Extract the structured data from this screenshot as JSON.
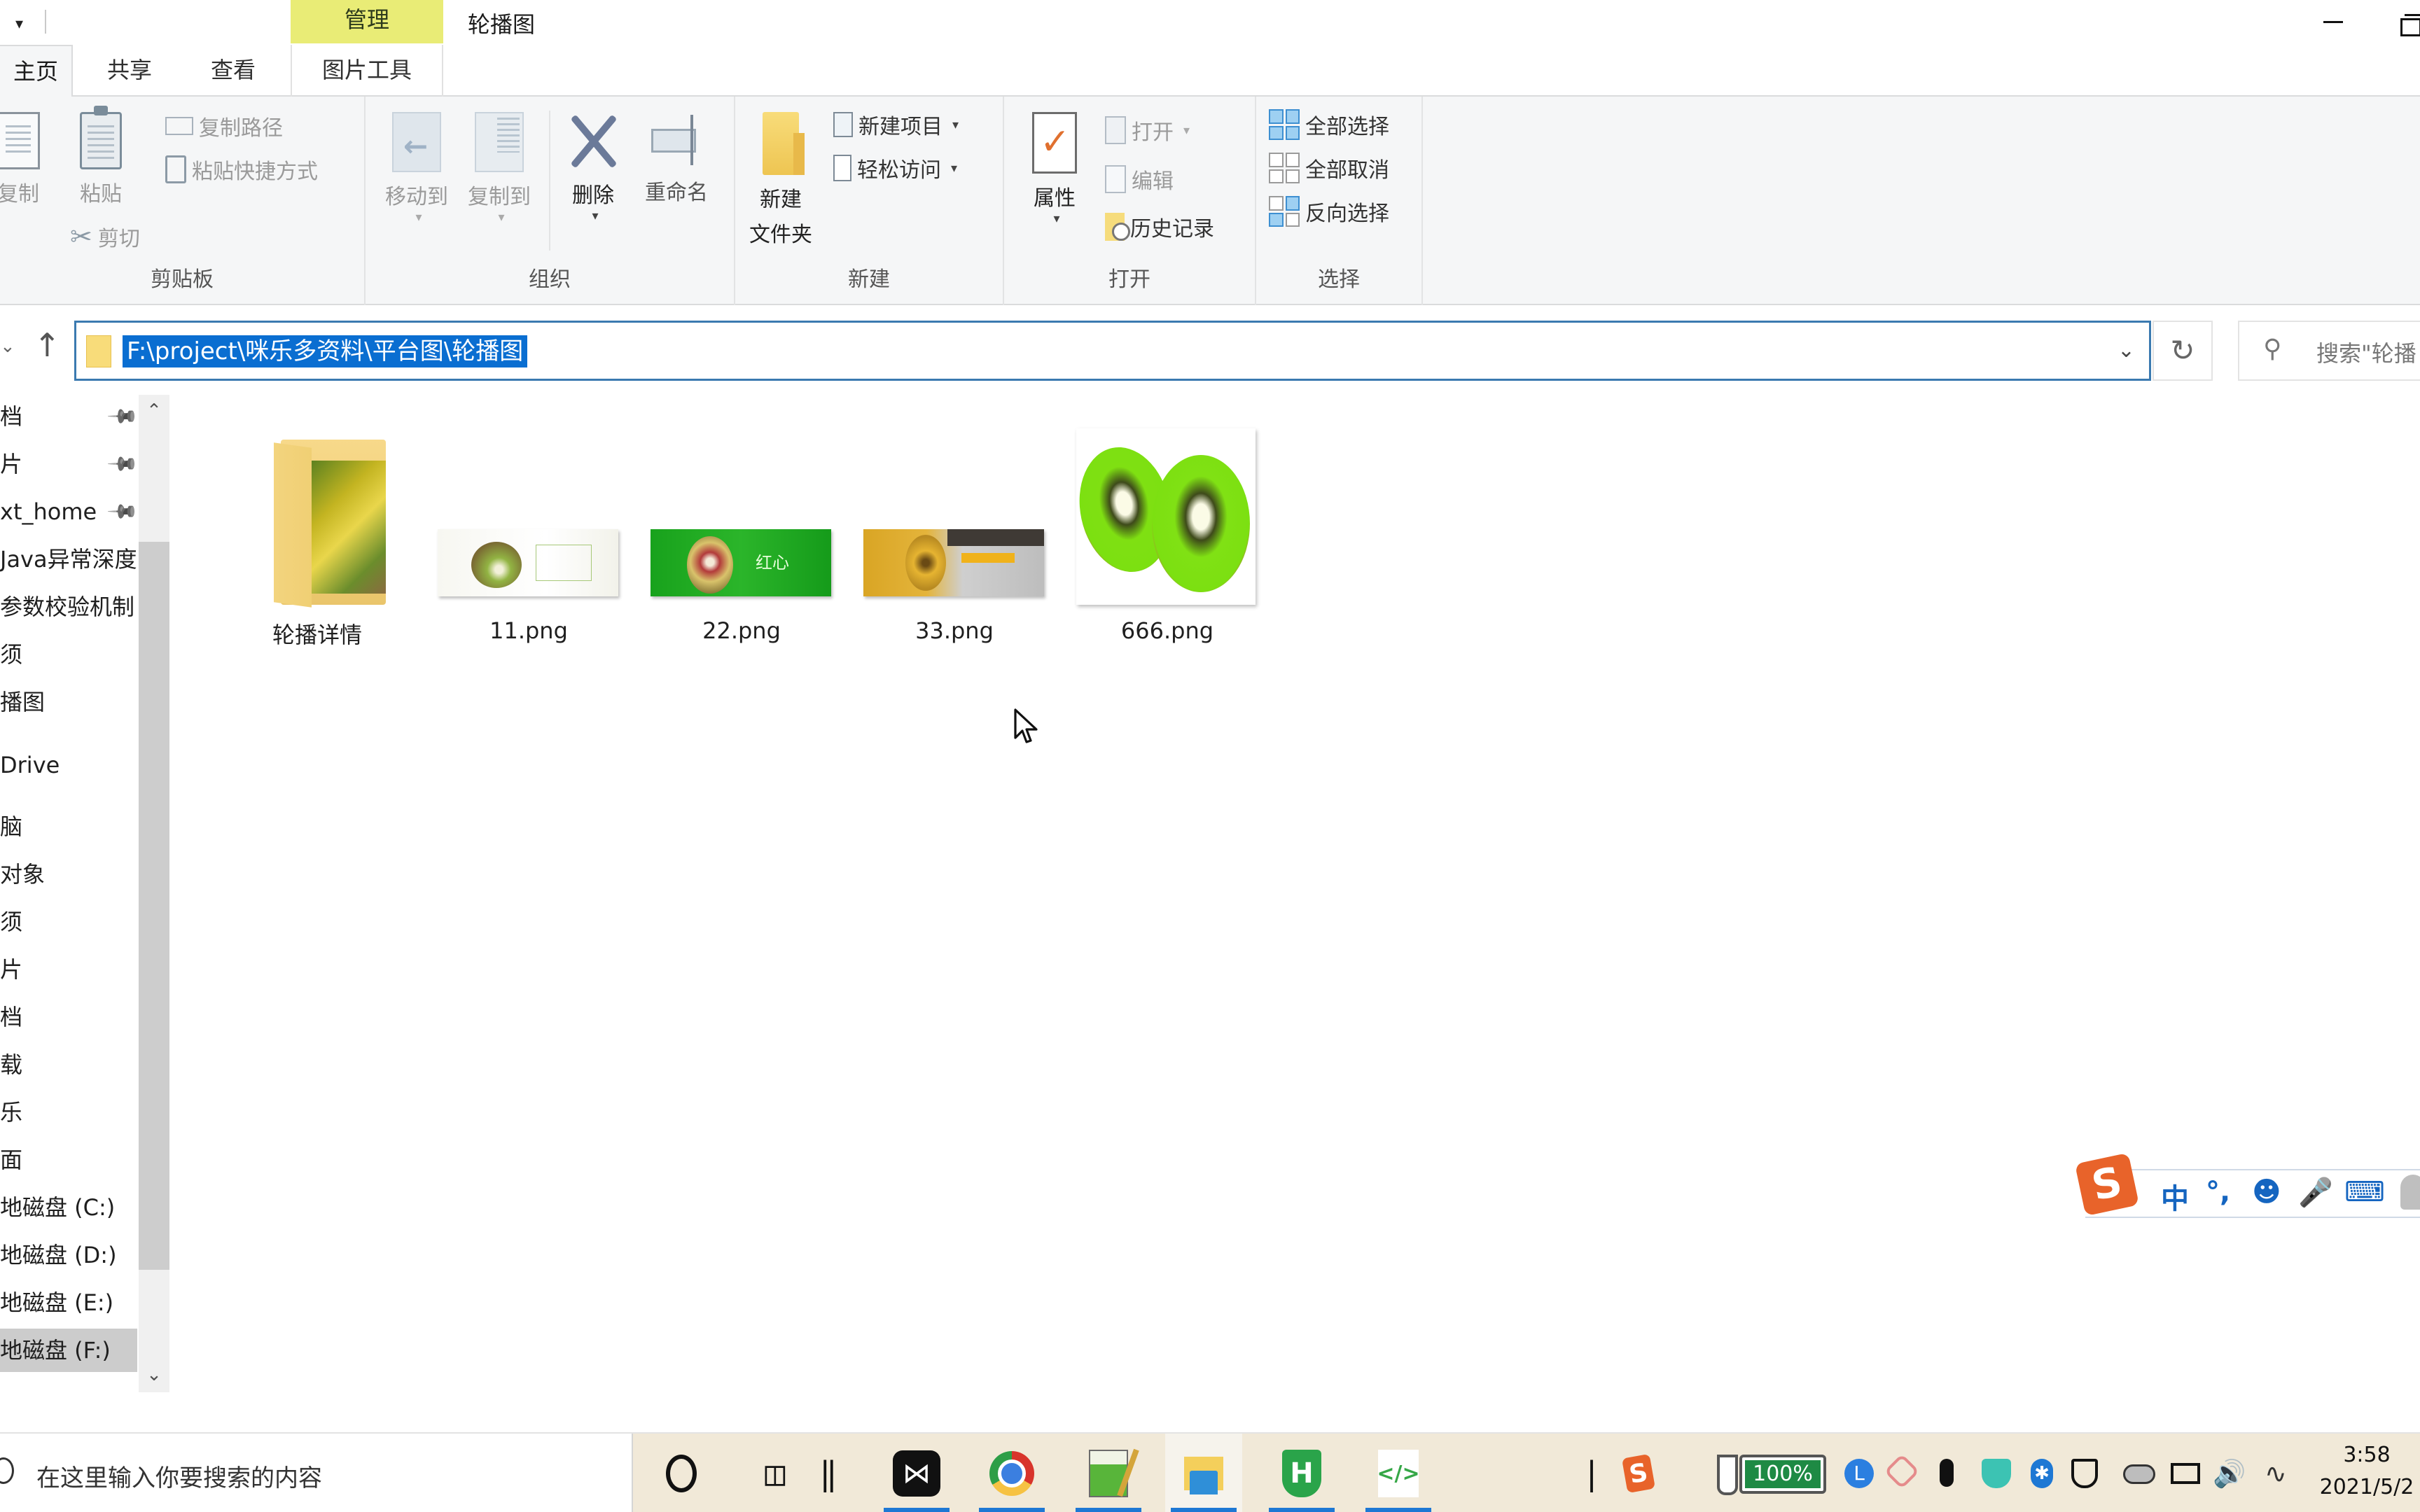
{
  "window": {
    "title": "轮播图",
    "context_tab_group": "管理",
    "controls": {
      "minimize": "minimize",
      "restore": "restore"
    }
  },
  "tabs": [
    {
      "label": "主页",
      "active": true
    },
    {
      "label": "共享",
      "active": false
    },
    {
      "label": "查看",
      "active": false
    },
    {
      "label": "图片工具",
      "active": false,
      "contextual": true
    }
  ],
  "ribbon": {
    "clipboard": {
      "label": "剪贴板",
      "copy": "复制",
      "paste": "粘贴",
      "copy_path": "复制路径",
      "paste_shortcut": "粘贴快捷方式",
      "cut": "剪切"
    },
    "organize": {
      "label": "组织",
      "move_to": "移动到",
      "copy_to": "复制到",
      "delete": "删除",
      "rename": "重命名"
    },
    "new": {
      "label": "新建",
      "new_folder_line1": "新建",
      "new_folder_line2": "文件夹",
      "new_item": "新建项目",
      "easy_access": "轻松访问"
    },
    "open": {
      "label": "打开",
      "properties": "属性",
      "open": "打开",
      "edit": "编辑",
      "history": "历史记录"
    },
    "select": {
      "label": "选择",
      "select_all": "全部选择",
      "select_none": "全部取消",
      "invert": "反向选择"
    }
  },
  "address": {
    "path": "F:\\project\\咪乐多资料\\平台图\\轮播图",
    "search_placeholder": "搜索\"轮播"
  },
  "nav_pane": {
    "items": [
      {
        "label": "档",
        "pinned": true
      },
      {
        "label": "片",
        "pinned": true
      },
      {
        "label": "xt_home",
        "pinned": true
      },
      {
        "label": "Java异常深度",
        "pinned": false
      },
      {
        "label": "参数校验机制",
        "pinned": false
      },
      {
        "label": "须",
        "pinned": false
      },
      {
        "label": "播图",
        "pinned": false
      },
      {
        "label": "Drive",
        "pinned": false
      },
      {
        "label": "脑",
        "pinned": false
      },
      {
        "label": "对象",
        "pinned": false
      },
      {
        "label": "须",
        "pinned": false
      },
      {
        "label": "片",
        "pinned": false
      },
      {
        "label": "档",
        "pinned": false
      },
      {
        "label": "载",
        "pinned": false
      },
      {
        "label": "乐",
        "pinned": false
      },
      {
        "label": "面",
        "pinned": false
      },
      {
        "label": "地磁盘 (C:)",
        "pinned": false
      },
      {
        "label": "地磁盘 (D:)",
        "pinned": false
      },
      {
        "label": "地磁盘 (E:)",
        "pinned": false
      },
      {
        "label": "地磁盘 (F:)",
        "pinned": false,
        "selected": true
      }
    ]
  },
  "files": [
    {
      "name": "轮播详情",
      "type": "folder"
    },
    {
      "name": "11.png",
      "type": "image"
    },
    {
      "name": "22.png",
      "type": "image"
    },
    {
      "name": "33.png",
      "type": "image"
    },
    {
      "name": "666.png",
      "type": "image"
    }
  ],
  "ime_toolbar": {
    "logo": "S",
    "mode": "中",
    "punct": "°,",
    "items": [
      "emoji-icon",
      "mic-icon",
      "keyboard-icon",
      "user-icon"
    ]
  },
  "taskbar": {
    "search_placeholder": "在这里输入你要搜索的内容",
    "apps": [
      "cortana",
      "task-view",
      "capcut",
      "chrome",
      "notepad",
      "file-explorer",
      "hbuilder",
      "code-editor"
    ],
    "battery_percent": "100%",
    "time": "3:58",
    "date": "2021/5/2"
  },
  "colors": {
    "accent": "#0a6ed1",
    "context_tab": "#e9ec76",
    "ribbon_bg": "#f5f6f7",
    "taskbar_bg": "#f1e9d8",
    "battery_green": "#1e8a44"
  }
}
